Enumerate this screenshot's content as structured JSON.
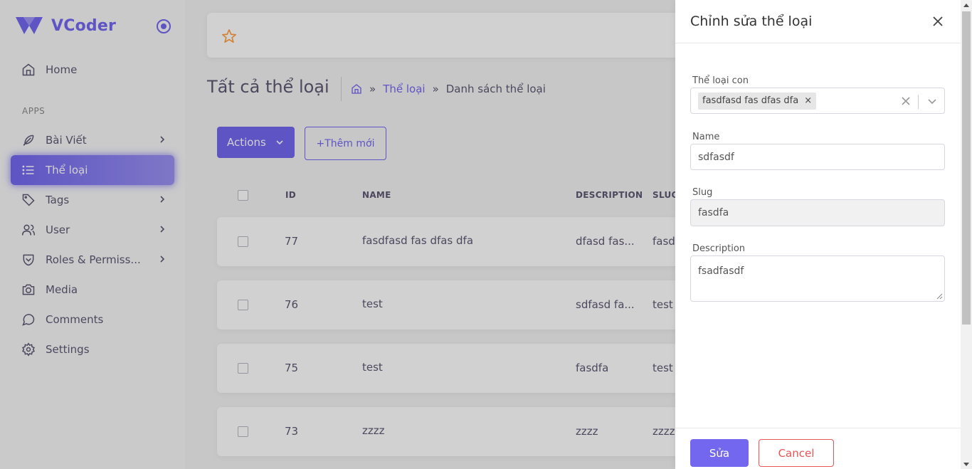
{
  "app": {
    "name": "VCoder"
  },
  "sidebar": {
    "section_apps": "APPS",
    "items": [
      {
        "label": "Home",
        "icon": "home-icon"
      },
      {
        "label": "Bài Viết",
        "icon": "feather-icon"
      },
      {
        "label": "Thể loại",
        "icon": "list-icon",
        "active": true
      },
      {
        "label": "Tags",
        "icon": "tag-icon"
      },
      {
        "label": "User",
        "icon": "users-icon"
      },
      {
        "label": "Roles & Permiss...",
        "icon": "shield-icon"
      },
      {
        "label": "Media",
        "icon": "camera-icon"
      },
      {
        "label": "Comments",
        "icon": "message-circle-icon"
      },
      {
        "label": "Settings",
        "icon": "gear-icon"
      }
    ]
  },
  "page": {
    "title": "Tất cả thể loại",
    "breadcrumb": {
      "link": "Thể loại",
      "current": "Danh sách thể loại",
      "sep": "»"
    },
    "actions_label": "Actions",
    "add_label": "+Thêm mới"
  },
  "table": {
    "headers": {
      "id": "ID",
      "name": "NAME",
      "description": "DESCRIPTION",
      "slug": "SLUG"
    },
    "rows": [
      {
        "id": "77",
        "name": "fasdfasd fas dfas dfa",
        "description": "dfasd fas...",
        "slug": "fasdf"
      },
      {
        "id": "76",
        "name": "test",
        "description": "sdfasd fa...",
        "slug": "test"
      },
      {
        "id": "75",
        "name": "test",
        "description": "fasdfa",
        "slug": "test"
      },
      {
        "id": "73",
        "name": "zzzz",
        "description": "zzzz",
        "slug": "zzzz"
      }
    ]
  },
  "panel": {
    "title": "Chỉnh sửa thể loại",
    "sub_category_label": "Thể loại con",
    "sub_category_tag": "fasdfasd fas dfas dfa",
    "name_label": "Name",
    "name_value": "sdfasdf",
    "slug_label": "Slug",
    "slug_value": "fasdfa",
    "description_label": "Description",
    "description_value": "fsadfasdf",
    "save_label": "Sửa",
    "cancel_label": "Cancel"
  },
  "colors": {
    "accent": "#7367f0",
    "danger": "#ea5455",
    "star": "#ff9f43"
  }
}
